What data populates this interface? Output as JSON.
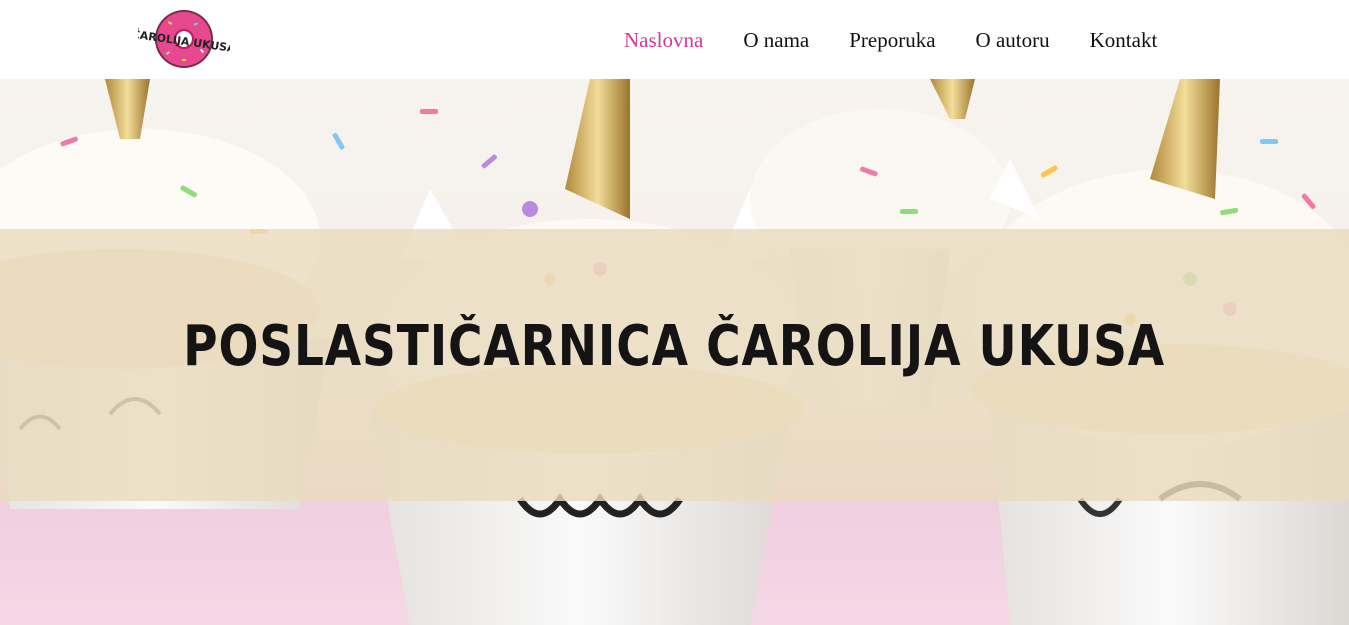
{
  "logo": {
    "text": "ČAROLIJA UKUSA",
    "icon": "donut-icon"
  },
  "nav": {
    "items": [
      {
        "label": "Naslovna",
        "active": true
      },
      {
        "label": "O nama",
        "active": false
      },
      {
        "label": "Preporuka",
        "active": false
      },
      {
        "label": "O autoru",
        "active": false
      },
      {
        "label": "Kontakt",
        "active": false
      }
    ]
  },
  "hero": {
    "headline": "POSLASTIČARNICA ČAROLIJA UKUSA"
  },
  "colors": {
    "accent": "#d4379a",
    "band": "#e9dabe",
    "text": "#141414"
  }
}
